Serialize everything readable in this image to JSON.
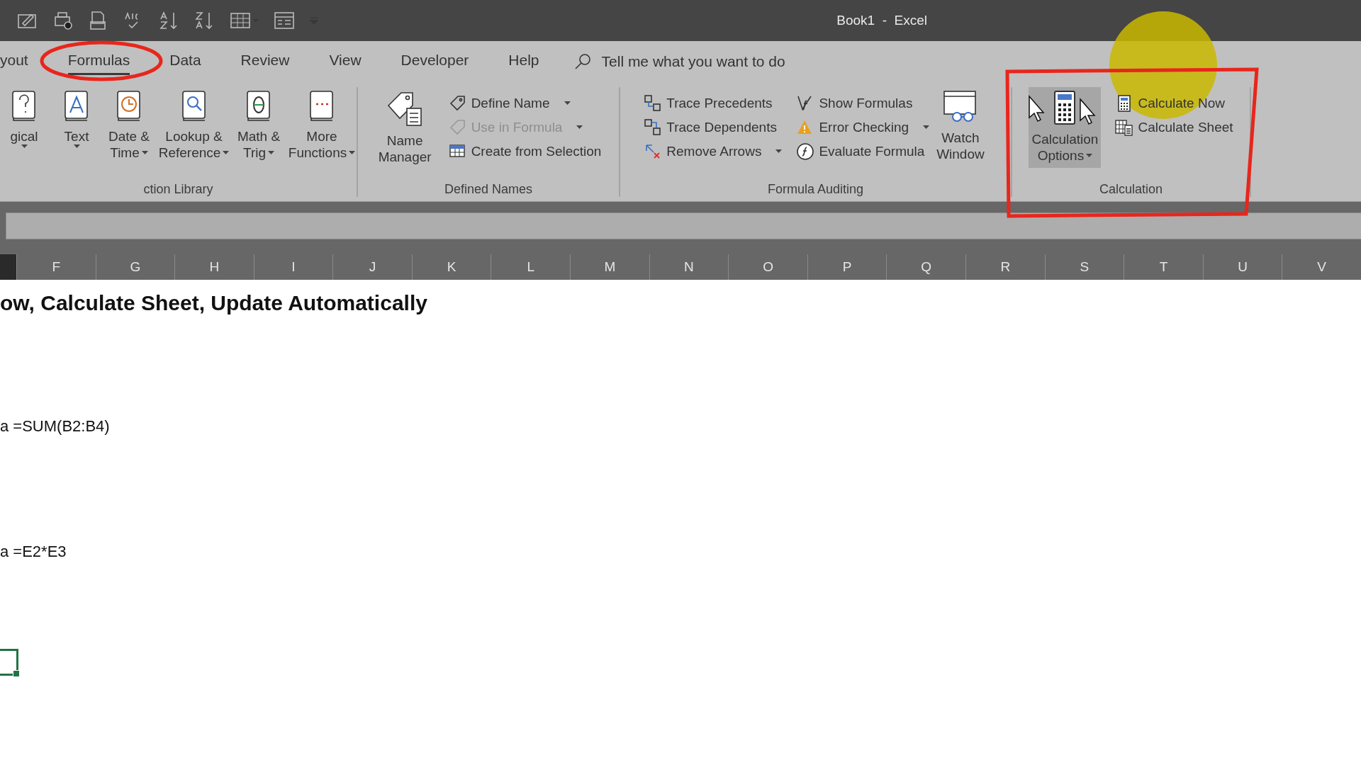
{
  "window": {
    "title": "Book1  -  Excel"
  },
  "ribbon_tabs": [
    {
      "label": "yout",
      "selected": false
    },
    {
      "label": "Formulas",
      "selected": true
    },
    {
      "label": "Data",
      "selected": false
    },
    {
      "label": "Review",
      "selected": false
    },
    {
      "label": "View",
      "selected": false
    },
    {
      "label": "Developer",
      "selected": false
    },
    {
      "label": "Help",
      "selected": false
    }
  ],
  "tell_me": {
    "placeholder": "Tell me what you want to do"
  },
  "groups": [
    {
      "label": "ction Library",
      "columns": [
        {
          "kind": "large",
          "lines": [
            "gical"
          ],
          "dropdown": true,
          "highlighted": false
        },
        {
          "kind": "large",
          "lines": [
            "Text"
          ],
          "dropdown": true,
          "highlighted": false
        },
        {
          "kind": "large",
          "lines": [
            "Date &",
            "Time"
          ],
          "dropdown": true,
          "highlighted": false
        },
        {
          "kind": "large",
          "lines": [
            "Lookup &",
            "Reference"
          ],
          "dropdown": true,
          "highlighted": false
        },
        {
          "kind": "large",
          "lines": [
            "Math &",
            "Trig"
          ],
          "dropdown": true,
          "highlighted": false
        },
        {
          "kind": "large",
          "lines": [
            "More",
            "Functions"
          ],
          "dropdown": true,
          "highlighted": false
        }
      ]
    },
    {
      "label": "Defined Names",
      "columns": [
        {
          "kind": "large",
          "lines": [
            "Name",
            "Manager"
          ],
          "dropdown": false,
          "highlighted": false
        },
        {
          "kind": "stack",
          "items": [
            {
              "label": "Define Name",
              "dropdown": true,
              "disabled": false
            },
            {
              "label": "Use in Formula",
              "dropdown": true,
              "disabled": true
            },
            {
              "label": "Create from Selection",
              "dropdown": false,
              "disabled": false
            }
          ]
        }
      ]
    },
    {
      "label": "Formula Auditing",
      "columns": [
        {
          "kind": "stack",
          "items": [
            {
              "label": "Trace Precedents",
              "dropdown": false,
              "disabled": false
            },
            {
              "label": "Trace Dependents",
              "dropdown": false,
              "disabled": false
            },
            {
              "label": "Remove Arrows",
              "dropdown": true,
              "disabled": false
            }
          ]
        },
        {
          "kind": "stack",
          "items": [
            {
              "label": "Show Formulas",
              "dropdown": false,
              "disabled": false
            },
            {
              "label": "Error Checking",
              "dropdown": true,
              "disabled": false
            },
            {
              "label": "Evaluate Formula",
              "dropdown": false,
              "disabled": false
            }
          ]
        },
        {
          "kind": "large",
          "lines": [
            "Watch",
            "Window"
          ],
          "dropdown": false,
          "highlighted": false
        }
      ]
    },
    {
      "label": "Calculation",
      "columns": [
        {
          "kind": "large",
          "lines": [
            "Calculation",
            "Options"
          ],
          "dropdown": true,
          "highlighted": true
        },
        {
          "kind": "stack",
          "items": [
            {
              "label": "Calculate Now",
              "dropdown": false,
              "disabled": false
            },
            {
              "label": "Calculate Sheet",
              "dropdown": false,
              "disabled": false
            }
          ]
        }
      ]
    }
  ],
  "columns": [
    "F",
    "G",
    "H",
    "I",
    "J",
    "K",
    "L",
    "M",
    "N",
    "O",
    "P",
    "Q",
    "R",
    "S",
    "T",
    "U",
    "V"
  ],
  "cells": [
    {
      "kind": "heading",
      "text": "ow, Calculate Sheet, Update Automatically"
    },
    {
      "kind": "text",
      "text": "a =SUM(B2:B4)"
    },
    {
      "kind": "text",
      "text": "a =E2*E3"
    }
  ]
}
